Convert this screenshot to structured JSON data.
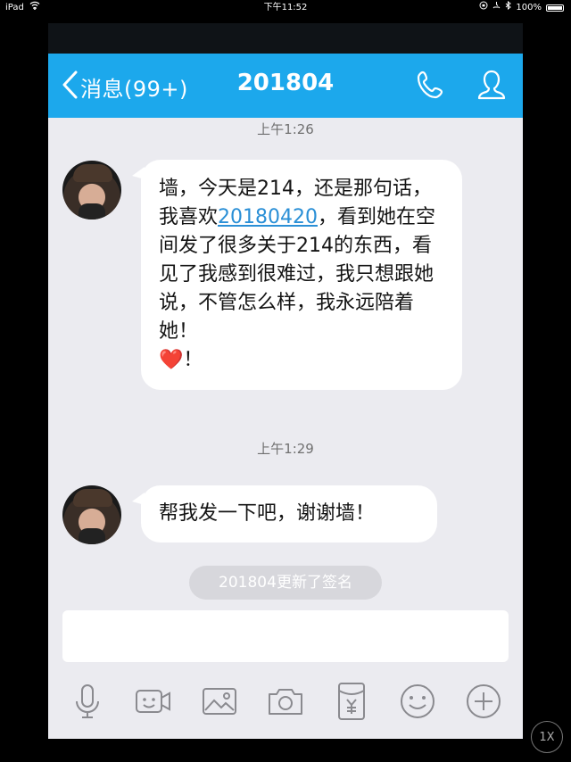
{
  "status_bar": {
    "device": "iPad",
    "time": "下午11:52",
    "battery": "100%"
  },
  "nav": {
    "back_label": "消息(99+)",
    "title": "201804"
  },
  "messages": [
    {
      "timestamp": "上午1:26",
      "text_before_link": "墙，今天是214，还是那句话，我喜欢",
      "link": "20180420",
      "text_after_link": "，看到她在空间发了很多关于214的东西，看见了我感到很难过，我只想跟她说，不管怎么样，我永远陪着她！",
      "heart": "❤️",
      "suffix": "！"
    },
    {
      "timestamp": "上午1:29",
      "text": "帮我发一下吧，谢谢墙！"
    }
  ],
  "system_notice": "201804更新了签名",
  "input": {
    "value": "",
    "placeholder": ""
  },
  "toolbar": {
    "icons": [
      "microphone-icon",
      "video-call-icon",
      "image-icon",
      "camera-icon",
      "red-packet-icon",
      "emoji-icon",
      "plus-icon"
    ]
  },
  "playback": {
    "speed_label": "1X"
  },
  "colors": {
    "nav_bg": "#1ca8ec",
    "chat_bg": "#ebebf0",
    "link": "#2a8fd6"
  }
}
